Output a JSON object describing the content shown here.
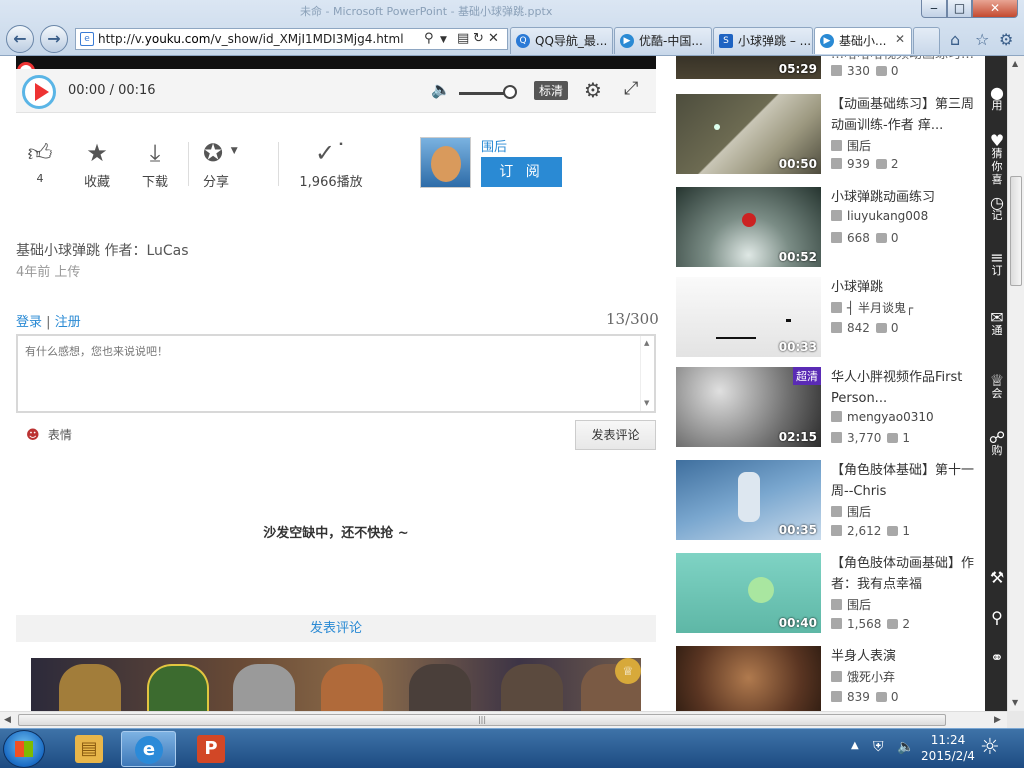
{
  "window": {
    "title": "未命 - Microsoft PowerPoint - 基础小球弹跳.pptx",
    "min": "‒",
    "max": "□",
    "close": "✕"
  },
  "browser": {
    "url_prefix": "http://v.",
    "url_domain": "youku.com",
    "url_path": "/v_show/id_XMjI1MDI3Mjg4.html",
    "tabs": [
      {
        "label": "QQ导航_最...",
        "icon": "qq-icon",
        "color": "#2b7ad6",
        "active": false
      },
      {
        "label": "优酷-中国...",
        "icon": "youku-icon",
        "color": "#2a8ad4",
        "active": false
      },
      {
        "label": "小球弹跳 – ...",
        "icon": "soku-icon",
        "color": "#1e63c2",
        "active": false
      },
      {
        "label": "基础小...",
        "icon": "ie-page-icon",
        "color": "#2a8ad4",
        "active": true
      }
    ]
  },
  "player": {
    "time": "00:00 / 00:16",
    "quality": "标清"
  },
  "actions": {
    "like_count": "4",
    "favorite": "收藏",
    "download": "下载",
    "share": "分享",
    "plays": "1,966播放"
  },
  "uploader": {
    "name": "围后",
    "subscribe": "订 阅"
  },
  "video": {
    "title": "基础小球弹跳 作者：LuCas",
    "uploaded": "4年前 上传"
  },
  "comments": {
    "login": "登录",
    "sep": "|",
    "register": "注册",
    "count": "13/300",
    "placeholder": "有什么感想，您也来说说吧！",
    "emoji": "表情",
    "post": "发表评论",
    "empty": "沙发空缺中，还不快抢 ~",
    "post_wide": "发表评论"
  },
  "sidebar": {
    "videos": [
      {
        "title": "…哈哈哈视频动画练习…",
        "author": "",
        "views": "330",
        "comments": "0",
        "duration": "05:29",
        "hd": ""
      },
      {
        "title": "【动画基础练习】第三周动画训练-作者 痒...",
        "author": "围后",
        "views": "939",
        "comments": "2",
        "duration": "00:50",
        "hd": ""
      },
      {
        "title": "小球弹跳动画练习",
        "author": "liuyukang008",
        "views": "668",
        "comments": "0",
        "duration": "00:52",
        "hd": ""
      },
      {
        "title": "小球弹跳",
        "author": "┤ 半月谈鬼┌",
        "views": "842",
        "comments": "0",
        "duration": "00:33",
        "hd": ""
      },
      {
        "title": "华人小胖视频作品First Person...",
        "author": "mengyao0310",
        "views": "3,770",
        "comments": "1",
        "duration": "02:15",
        "hd": "超清"
      },
      {
        "title": "【角色肢体基础】第十一周--Chris",
        "author": "围后",
        "views": "2,612",
        "comments": "1",
        "duration": "00:35",
        "hd": ""
      },
      {
        "title": "【角色肢体动画基础】作者：我有点幸福",
        "author": "围后",
        "views": "1,568",
        "comments": "2",
        "duration": "00:40",
        "hd": ""
      },
      {
        "title": "半身人表演",
        "author": "饿死小弃",
        "views": "839",
        "comments": "0",
        "duration": "",
        "hd": ""
      }
    ]
  },
  "right_strip": {
    "items": [
      "用",
      "猜你喜",
      "记",
      "订",
      "通",
      "会",
      "购"
    ]
  },
  "taskbar": {
    "time": "11:24",
    "date": "2015/2/4",
    "apps": [
      {
        "name": "explorer-icon",
        "color": "#e8b64a",
        "label": "▤"
      },
      {
        "name": "ie-icon",
        "color": "#2b8ad8",
        "label": "e"
      },
      {
        "name": "powerpoint-icon",
        "color": "#d24726",
        "label": "P"
      }
    ]
  }
}
